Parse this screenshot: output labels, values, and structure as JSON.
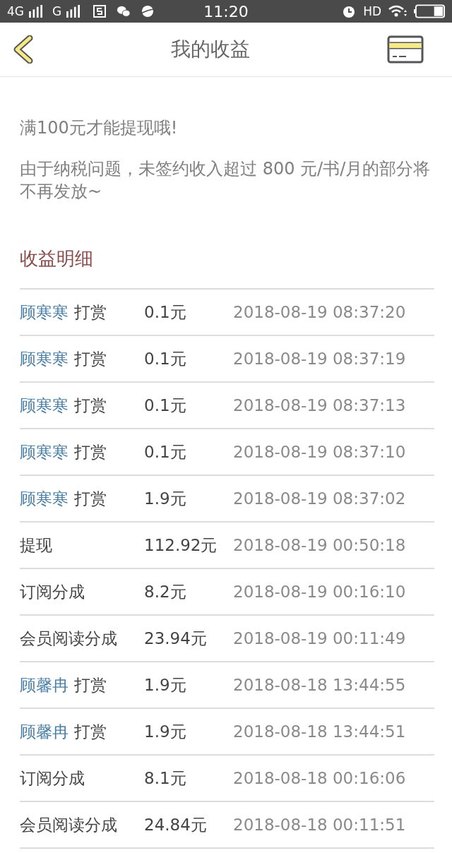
{
  "status_bar": {
    "network_1": "4G",
    "network_2": "G",
    "time": "11:20",
    "hd": "HD"
  },
  "header": {
    "title": "我的收益"
  },
  "notices": [
    "满100元才能提现哦!",
    "由于纳税问题，未签约收入超过 800 元/书/月的部分将不再发放~"
  ],
  "section_title": "收益明细",
  "rows": [
    {
      "kind": "reward",
      "name": "顾寒寒",
      "action": "打赏",
      "amount": "0.1元",
      "time": "2018-08-19 08:37:20"
    },
    {
      "kind": "reward",
      "name": "顾寒寒",
      "action": "打赏",
      "amount": "0.1元",
      "time": "2018-08-19 08:37:19"
    },
    {
      "kind": "reward",
      "name": "顾寒寒",
      "action": "打赏",
      "amount": "0.1元",
      "time": "2018-08-19 08:37:13"
    },
    {
      "kind": "reward",
      "name": "顾寒寒",
      "action": "打赏",
      "amount": "0.1元",
      "time": "2018-08-19 08:37:10"
    },
    {
      "kind": "reward",
      "name": "顾寒寒",
      "action": "打赏",
      "amount": "1.9元",
      "time": "2018-08-19 08:37:02"
    },
    {
      "kind": "plain",
      "label": "提现",
      "amount": "112.92元",
      "time": "2018-08-19 00:50:18"
    },
    {
      "kind": "plain",
      "label": "订阅分成",
      "amount": "8.2元",
      "time": "2018-08-19 00:16:10"
    },
    {
      "kind": "plain",
      "label": "会员阅读分成",
      "amount": "23.94元",
      "time": "2018-08-19 00:11:49"
    },
    {
      "kind": "reward",
      "name": "顾馨冉",
      "action": "打赏",
      "amount": "1.9元",
      "time": "2018-08-18 13:44:55"
    },
    {
      "kind": "reward",
      "name": "顾馨冉",
      "action": "打赏",
      "amount": "1.9元",
      "time": "2018-08-18 13:44:51"
    },
    {
      "kind": "plain",
      "label": "订阅分成",
      "amount": "8.1元",
      "time": "2018-08-18 00:16:06"
    },
    {
      "kind": "plain",
      "label": "会员阅读分成",
      "amount": "24.84元",
      "time": "2018-08-18 00:11:51"
    }
  ]
}
